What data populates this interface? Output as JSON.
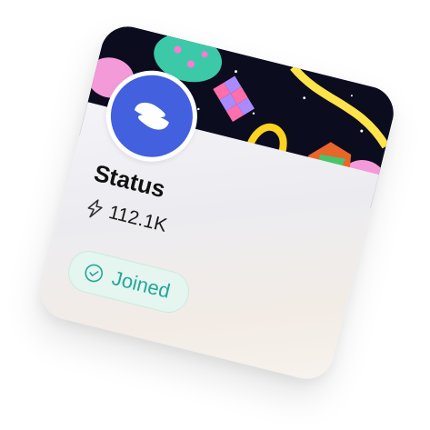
{
  "community": {
    "name": "Status",
    "members": "112.1K",
    "join_status": "Joined"
  },
  "colors": {
    "avatar_bg": "#4360df",
    "joined_text": "#26a69a",
    "joined_bg": "#e5f5ef"
  },
  "icons": {
    "avatar": "status-logo-icon",
    "members": "lightning-bolt-icon",
    "joined": "check-circle-icon"
  }
}
